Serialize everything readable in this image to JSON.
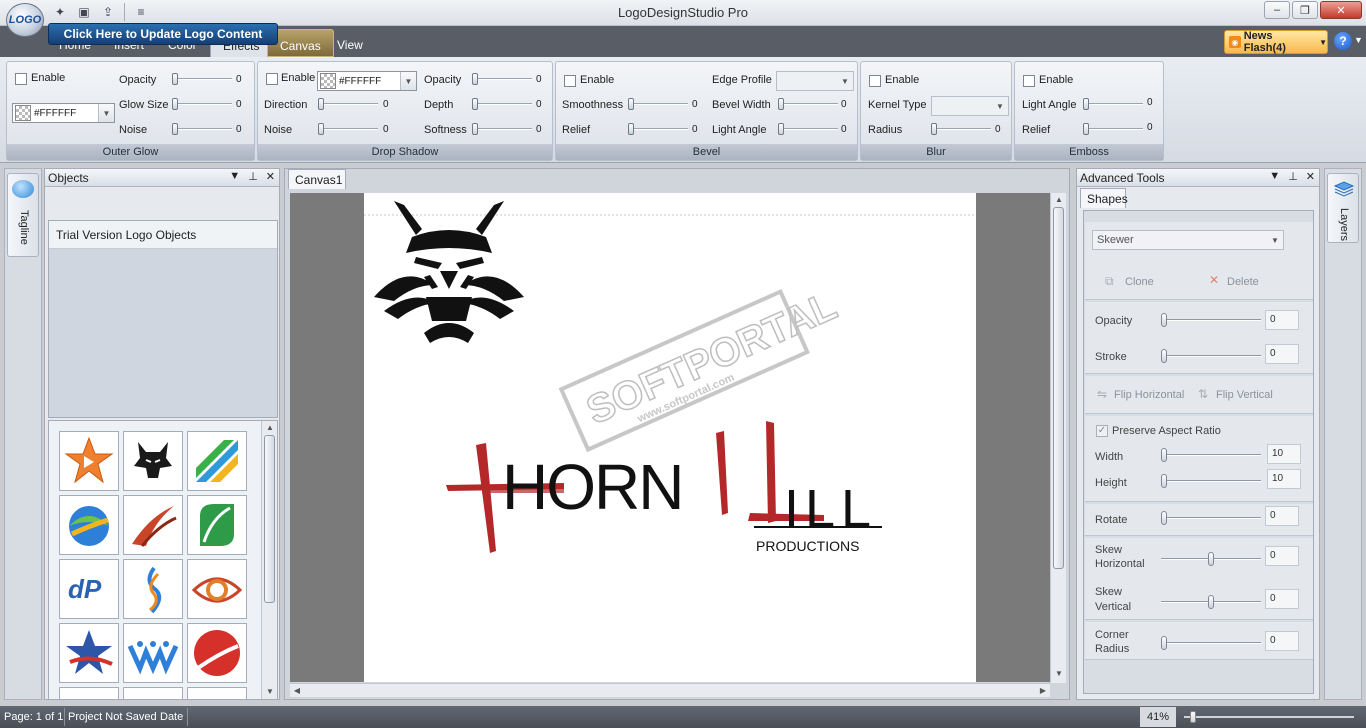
{
  "app": {
    "orb_label": "LOGO",
    "title": "LogoDesignStudio Pro"
  },
  "tabs": [
    "Home",
    "Insert",
    "Color",
    "Effects",
    "Canvas",
    "View"
  ],
  "header_right": {
    "news_label": "News Flash(4)",
    "help": "?"
  },
  "ribbon": {
    "outer_glow": {
      "title": "Outer Glow",
      "enable": "Enable",
      "color": "#FFFFFF",
      "opacity_label": "Opacity",
      "opacity": "0",
      "glow_size_label": "Glow Size",
      "glow_size": "0",
      "noise_label": "Noise",
      "noise": "0"
    },
    "drop_shadow": {
      "title": "Drop Shadow",
      "enable": "Enable",
      "color": "#FFFFFF",
      "direction_label": "Direction",
      "direction": "0",
      "noise_label": "Noise",
      "noise": "0",
      "opacity_label": "Opacity",
      "opacity": "0",
      "depth_label": "Depth",
      "depth": "0",
      "softness_label": "Softness",
      "softness": "0"
    },
    "bevel": {
      "title": "Bevel",
      "enable": "Enable",
      "smoothness_label": "Smoothness",
      "smoothness": "0",
      "relief_label": "Relief",
      "relief": "0",
      "edge_profile_label": "Edge Profile",
      "bevel_width_label": "Bevel Width",
      "bevel_width": "0",
      "light_angle_label": "Light Angle",
      "light_angle": "0"
    },
    "blur": {
      "title": "Blur",
      "enable": "Enable",
      "kernel_type_label": "Kernel Type",
      "radius_label": "Radius",
      "radius": "0"
    },
    "emboss": {
      "title": "Emboss",
      "enable": "Enable",
      "light_angle_label": "Light Angle",
      "light_angle": "0",
      "relief_label": "Relief",
      "relief": "0"
    }
  },
  "left_rail": {
    "tagline": "Tagline"
  },
  "right_rail": {
    "layers": "Layers"
  },
  "objects_panel": {
    "title": "Objects",
    "update_button": "Click Here to Update Logo Content",
    "list_items": [
      "Trial Version Logo Objects"
    ]
  },
  "canvas": {
    "tab": "Canvas1",
    "logo_text_1": "HORN",
    "logo_text_2": "ILL",
    "logo_sub": "PRODUCTIONS",
    "watermark_brand": "SOFTPORTAL",
    "watermark_url": "www.softportal.com"
  },
  "advanced_tools": {
    "title": "Advanced Tools",
    "tab": "Shapes",
    "shape_select": "Skewer",
    "clone": "Clone",
    "delete": "Delete",
    "opacity_label": "Opacity",
    "opacity": "0",
    "stroke_label": "Stroke",
    "stroke": "0",
    "flip_h": "Flip Horizontal",
    "flip_v": "Flip Vertical",
    "preserve_aspect": "Preserve Aspect Ratio",
    "width_label": "Width",
    "width": "10",
    "height_label": "Height",
    "height": "10",
    "rotate_label": "Rotate",
    "rotate": "0",
    "skew_h_label_1": "Skew",
    "skew_h_label_2": "Horizontal",
    "skew_h": "0",
    "skew_v_label_1": "Skew",
    "skew_v_label_2": "Vertical",
    "skew_v": "0",
    "corner_label_1": "Corner",
    "corner_label_2": "Radius",
    "corner": "0"
  },
  "status": {
    "page": "Page: 1 of 1",
    "saved": "Project Not Saved",
    "date": "Date",
    "zoom": "41%"
  }
}
